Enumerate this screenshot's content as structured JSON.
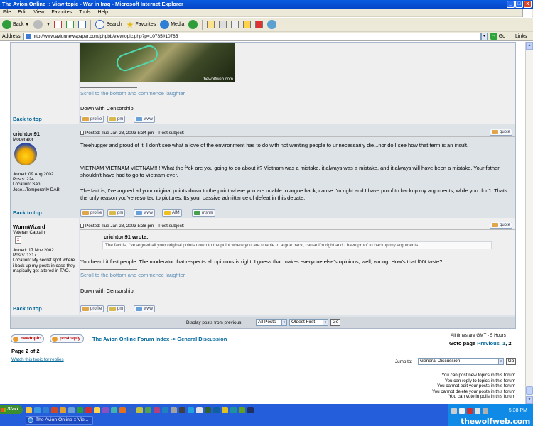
{
  "window": {
    "title": "The Avion Online :: View topic - War in Iraq - Microsoft Internet Explorer",
    "minimize": "_",
    "maximize": "□",
    "close": "x"
  },
  "menu": [
    "File",
    "Edit",
    "View",
    "Favorites",
    "Tools",
    "Help"
  ],
  "toolbar": {
    "back": "Back",
    "search": "Search",
    "favorites": "Favorites",
    "media": "Media"
  },
  "address": {
    "label": "Address",
    "url": "http://www.avionnewspaper.com/phpbb/viewtopic.php?p=10785#10785",
    "go": "Go",
    "links": "Links"
  },
  "posts": [
    {
      "image_caption": "thewolfweb.com",
      "sig_link": "Scroll to the bottom and commence laughter",
      "sig_text": "Down with Censorship!",
      "back_to_top": "Back to top",
      "buttons": [
        "profile",
        "pm",
        "www"
      ]
    },
    {
      "author": "crichton91",
      "rank": "Moderator",
      "joined": "Joined: 09 Aug 2002",
      "posts": "Posts: 224",
      "location": "Location: San Jose...Temporarily DAB",
      "posted": "Posted: Tue Jan 28, 2003 5:34 pm",
      "subject": "Post subject:",
      "quote_btn": "quote",
      "body1": "Treehugger and proud of it. I don't see what a love of the environment has to do with not wanting people to unnecessarily die...nor do I see how that term is an insult.",
      "body2": "VIETNAM VIETNAM VIETNAM!!!! What the f*ck are you going to do about it? Vietnam was a mistake, it always was a mistake, and it always will have been a mistake. Your father shouldn't have had to go to Vietnam ever.",
      "body3": "The fact is, I've argued all your original points down to the point where you are unable to argue back, cause I'm right and I have proof to backup my arguments, while you don't. Thats the only reason you've resorted to pictures. Its your passive admittance of defeat in this debate.",
      "back_to_top": "Back to top",
      "buttons": [
        "profile",
        "pm",
        "www",
        "AIM",
        "msnm"
      ]
    },
    {
      "author": "WurmWizard",
      "rank": "Veteran Captain",
      "joined": "Joined: 17 Nov 2002",
      "posts": "Posts: 1317",
      "location": "Location: My secret spot where i back up my posts in case they magically get altered in TAO.",
      "posted": "Posted: Tue Jan 28, 2003 5:38 pm",
      "subject": "Post subject:",
      "quote_btn": "quote",
      "quote_author": "crichton91 wrote:",
      "quote_text": "The fact is, I've argued all your original points down to the point where you are unable to argue back, cause I'm right and I have proof to backup my arguments",
      "body": "You heard it first people. The moderator that respects all opinions is right. I guess that makes everyone else's opinions, well, wrong! How's that f00t taste?",
      "sig_link": "Scroll to the bottom and commence laughter",
      "sig_text": "Down with Censorship!",
      "back_to_top": "Back to top",
      "buttons": [
        "profile",
        "pm",
        "www"
      ]
    }
  ],
  "display": {
    "label": "Display posts from previous:",
    "all_posts": "All Posts",
    "order": "Oldest First",
    "go": "Go"
  },
  "footer": {
    "newtopic": "newtopic",
    "postreply": "postreply",
    "breadcrumb_index": "The Avion Online Forum Index",
    "breadcrumb_sep": "->",
    "breadcrumb_forum": "General Discussion",
    "timezone": "All times are GMT - 5 Hours",
    "goto_label": "Goto page",
    "previous": "Previous",
    "page1": "1",
    "page2": "2",
    "page_of": "Page 2 of 2",
    "watch": "Watch this topic for replies",
    "jump_label": "Jump to:",
    "jump_value": "General Discussion",
    "jump_go": "Go",
    "perms": [
      "You can post new topics in this forum",
      "You can reply to topics in this forum",
      "You cannot edit your posts in this forum",
      "You cannot delete your posts in this forum",
      "You can vote in polls in this forum"
    ]
  },
  "taskbar": {
    "start": "Start",
    "task": "The Avion Online :: Vie...",
    "clock": "5:38 PM",
    "watermark": "thewolfweb.com"
  },
  "colors": {
    "link": "#006699",
    "row_light": "#efefef",
    "row_dark": "#dee3e7",
    "titlebar": "#0a5ce0",
    "taskbar": "#245edb"
  }
}
